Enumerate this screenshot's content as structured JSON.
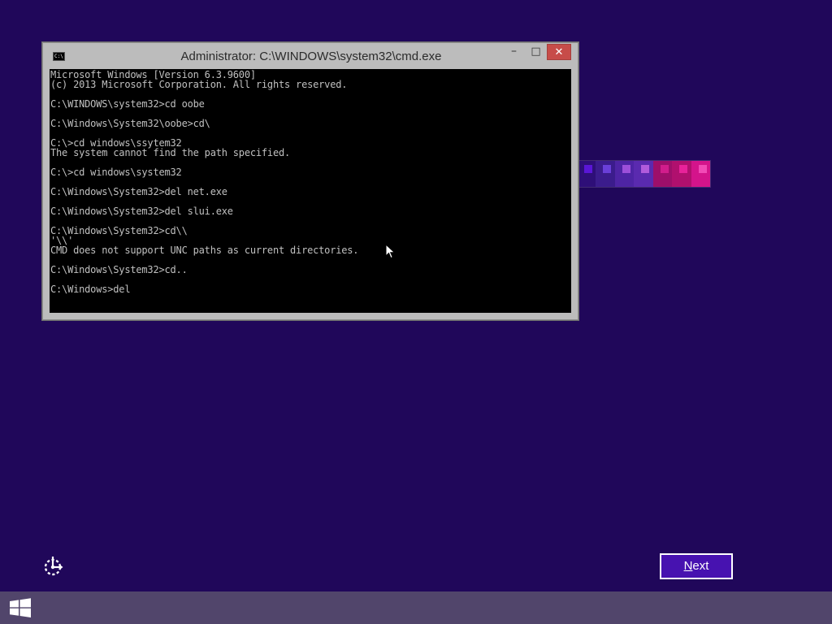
{
  "cmd_window": {
    "title": "Administrator: C:\\WINDOWS\\system32\\cmd.exe",
    "icon": "cmd-icon",
    "icon_text": "C:\\",
    "minimize_label": "–",
    "maximize_label": "□",
    "close_label": "✕",
    "console_lines": [
      "Microsoft Windows [Version 6.3.9600]",
      "(c) 2013 Microsoft Corporation. All rights reserved.",
      "",
      "C:\\WINDOWS\\system32>cd oobe",
      "",
      "C:\\Windows\\System32\\oobe>cd\\",
      "",
      "C:\\>cd windows\\ssytem32",
      "The system cannot find the path specified.",
      "",
      "C:\\>cd windows\\system32",
      "",
      "C:\\Windows\\System32>del net.exe",
      "",
      "C:\\Windows\\System32>del slui.exe",
      "",
      "C:\\Windows\\System32>cd\\\\",
      "'\\\\'",
      "CMD does not support UNC paths as current directories.",
      "",
      "C:\\Windows\\System32>cd..",
      "",
      "C:\\Windows>del"
    ]
  },
  "tile_strip": {
    "tiles": [
      {
        "bg": "#2e0f78",
        "dot": "#5a16d6"
      },
      {
        "bg": "#3b1c8c",
        "dot": "#6a3fd8"
      },
      {
        "bg": "#4e24a4",
        "dot": "#9c4fd9"
      },
      {
        "bg": "#5a2aaf",
        "dot": "#b05bdc"
      },
      {
        "bg": "#9d0f6a",
        "dot": "#d11d8c"
      },
      {
        "bg": "#b0106e",
        "dot": "#e8229a"
      },
      {
        "bg": "#d4148b",
        "dot": "#f24ab6"
      }
    ]
  },
  "ease_of_access": {
    "icon": "ease-of-access-icon"
  },
  "next_button": {
    "mnemonic": "N",
    "rest": "ext"
  },
  "taskbar": {
    "start_icon": "windows-logo-icon"
  },
  "colors": {
    "background": "#20075a",
    "accent": "#4712b0",
    "taskbar": "#51456b",
    "close_button": "#c74c49",
    "console_text": "#c0c0c0"
  }
}
